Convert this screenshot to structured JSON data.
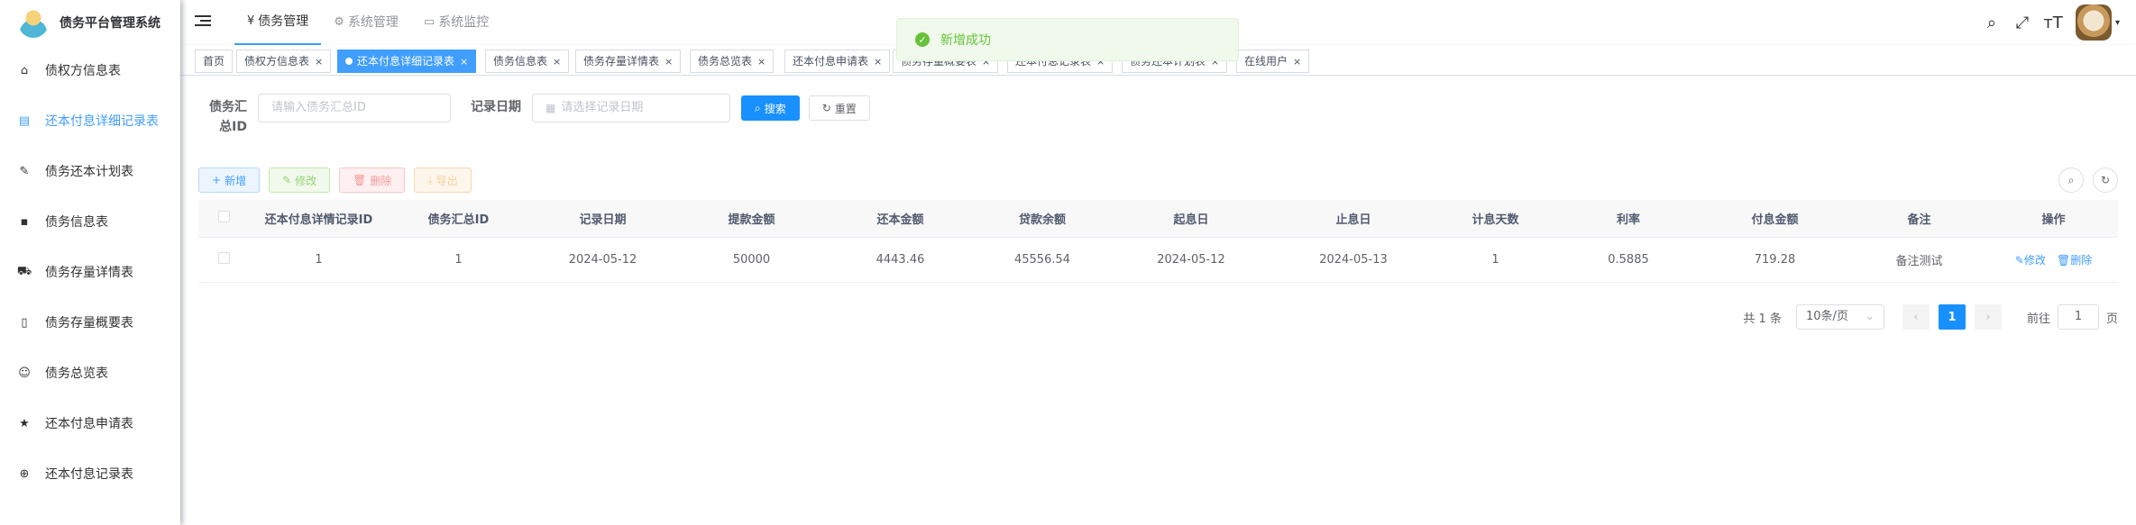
{
  "app": {
    "title": "债务平台管理系统"
  },
  "sidebar": {
    "items": [
      {
        "label": "债权方信息表",
        "icon": "home-icon"
      },
      {
        "label": "还本付息详细记录表",
        "icon": "document-icon",
        "active": true
      },
      {
        "label": "债务还本计划表",
        "icon": "edit-icon"
      },
      {
        "label": "债务信息表",
        "icon": "chat-icon"
      },
      {
        "label": "债务存量详情表",
        "icon": "cart-icon"
      },
      {
        "label": "债务存量概要表",
        "icon": "book-icon"
      },
      {
        "label": "债务总览表",
        "icon": "smile-icon"
      },
      {
        "label": "还本付息申请表",
        "icon": "star-icon"
      },
      {
        "label": "还本付息记录表",
        "icon": "plus-circle-icon"
      }
    ]
  },
  "topnav": {
    "menus": [
      {
        "label": "债务管理",
        "icon": "¥"
      },
      {
        "label": "系统管理",
        "icon": "⚙"
      },
      {
        "label": "系统监控",
        "icon": "▭"
      }
    ]
  },
  "tags": [
    {
      "label": "首页"
    },
    {
      "label": "债权方信息表"
    },
    {
      "label": "还本付息详细记录表"
    },
    {
      "label": "债务信息表"
    },
    {
      "label": "债务存量详情表"
    },
    {
      "label": "债务总览表"
    },
    {
      "label": "还本付息申请表"
    },
    {
      "label": "债务存量概要表"
    },
    {
      "label": "还本付息记录表"
    },
    {
      "label": "债务还本计划表"
    },
    {
      "label": "在线用户"
    }
  ],
  "toast": {
    "message": "新增成功"
  },
  "search": {
    "field1_label": "债务汇总ID",
    "field1_placeholder": "请输入债务汇总ID",
    "field2_label": "记录日期",
    "field2_placeholder": "请选择记录日期",
    "search_btn": "搜索",
    "reset_btn": "重置"
  },
  "toolbar": {
    "add": "新增",
    "edit": "修改",
    "delete": "删除",
    "export": "导出"
  },
  "table": {
    "columns": [
      "还本付息详情记录ID",
      "债务汇总ID",
      "记录日期",
      "提款金额",
      "还本金额",
      "贷款余额",
      "起息日",
      "止息日",
      "计息天数",
      "利率",
      "付息金额",
      "备注",
      "操作"
    ],
    "rows": [
      [
        "1",
        "1",
        "2024-05-12",
        "50000",
        "4443.46",
        "45556.54",
        "2024-05-12",
        "2024-05-13",
        "1",
        "0.5885",
        "719.28",
        "备注测试"
      ]
    ],
    "row_actions": {
      "edit": "修改",
      "delete": "删除"
    }
  },
  "pagination": {
    "total": "共 1 条",
    "page_size": "10条/页",
    "current": "1",
    "goto_prefix": "前往",
    "goto_value": "1",
    "goto_suffix": "页"
  },
  "colors": {
    "primary": "#1890ff",
    "success": "#67c23a",
    "danger": "#f56c6c",
    "warning": "#e6a23c"
  }
}
